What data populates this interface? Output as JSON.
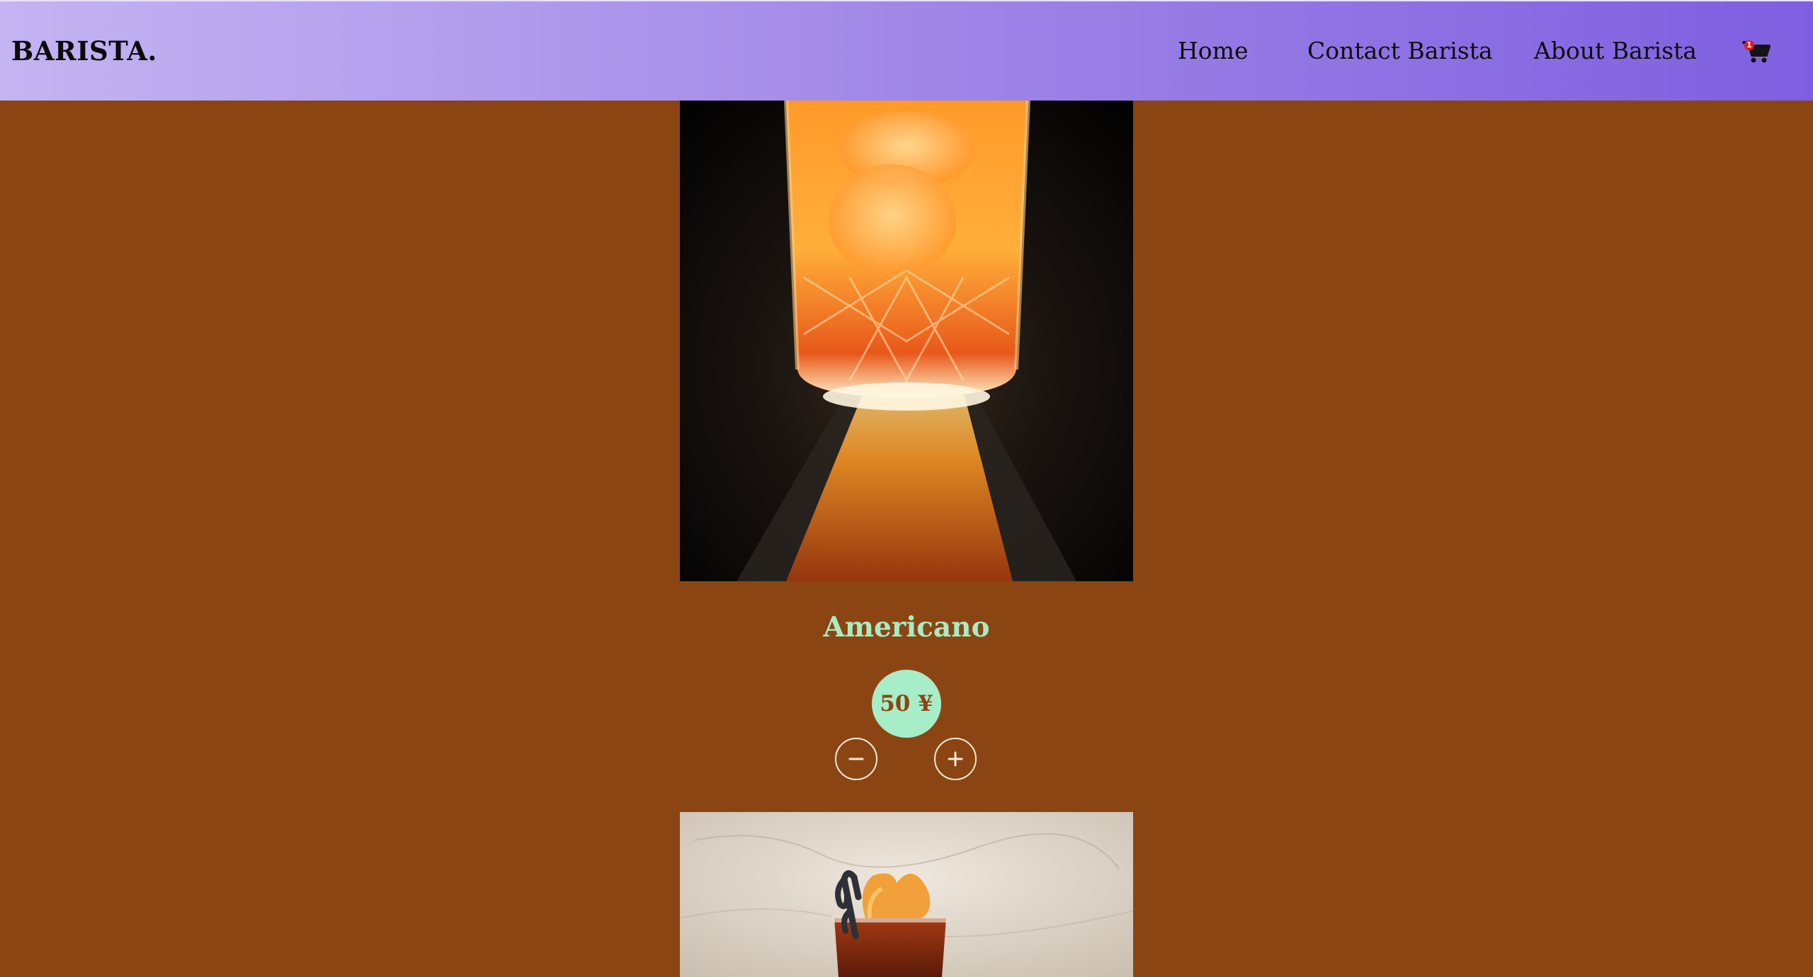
{
  "navbar": {
    "brand": "BARISTA.",
    "links": {
      "home": "Home",
      "contact": "Contact Barista",
      "about": "About Barista"
    },
    "cart": {
      "icon": "cart-icon",
      "count": "1"
    }
  },
  "product": {
    "name": "Americano",
    "price": "50 ¥",
    "decrement_icon": "minus-icon",
    "increment_icon": "plus-icon"
  },
  "colors": {
    "page_background": "#8B4513",
    "nav_gradient_start": "#c4b4f2",
    "nav_gradient_end": "#7e5fe0",
    "accent_mint": "#a7edc7",
    "badge_red": "#e01b1b"
  }
}
